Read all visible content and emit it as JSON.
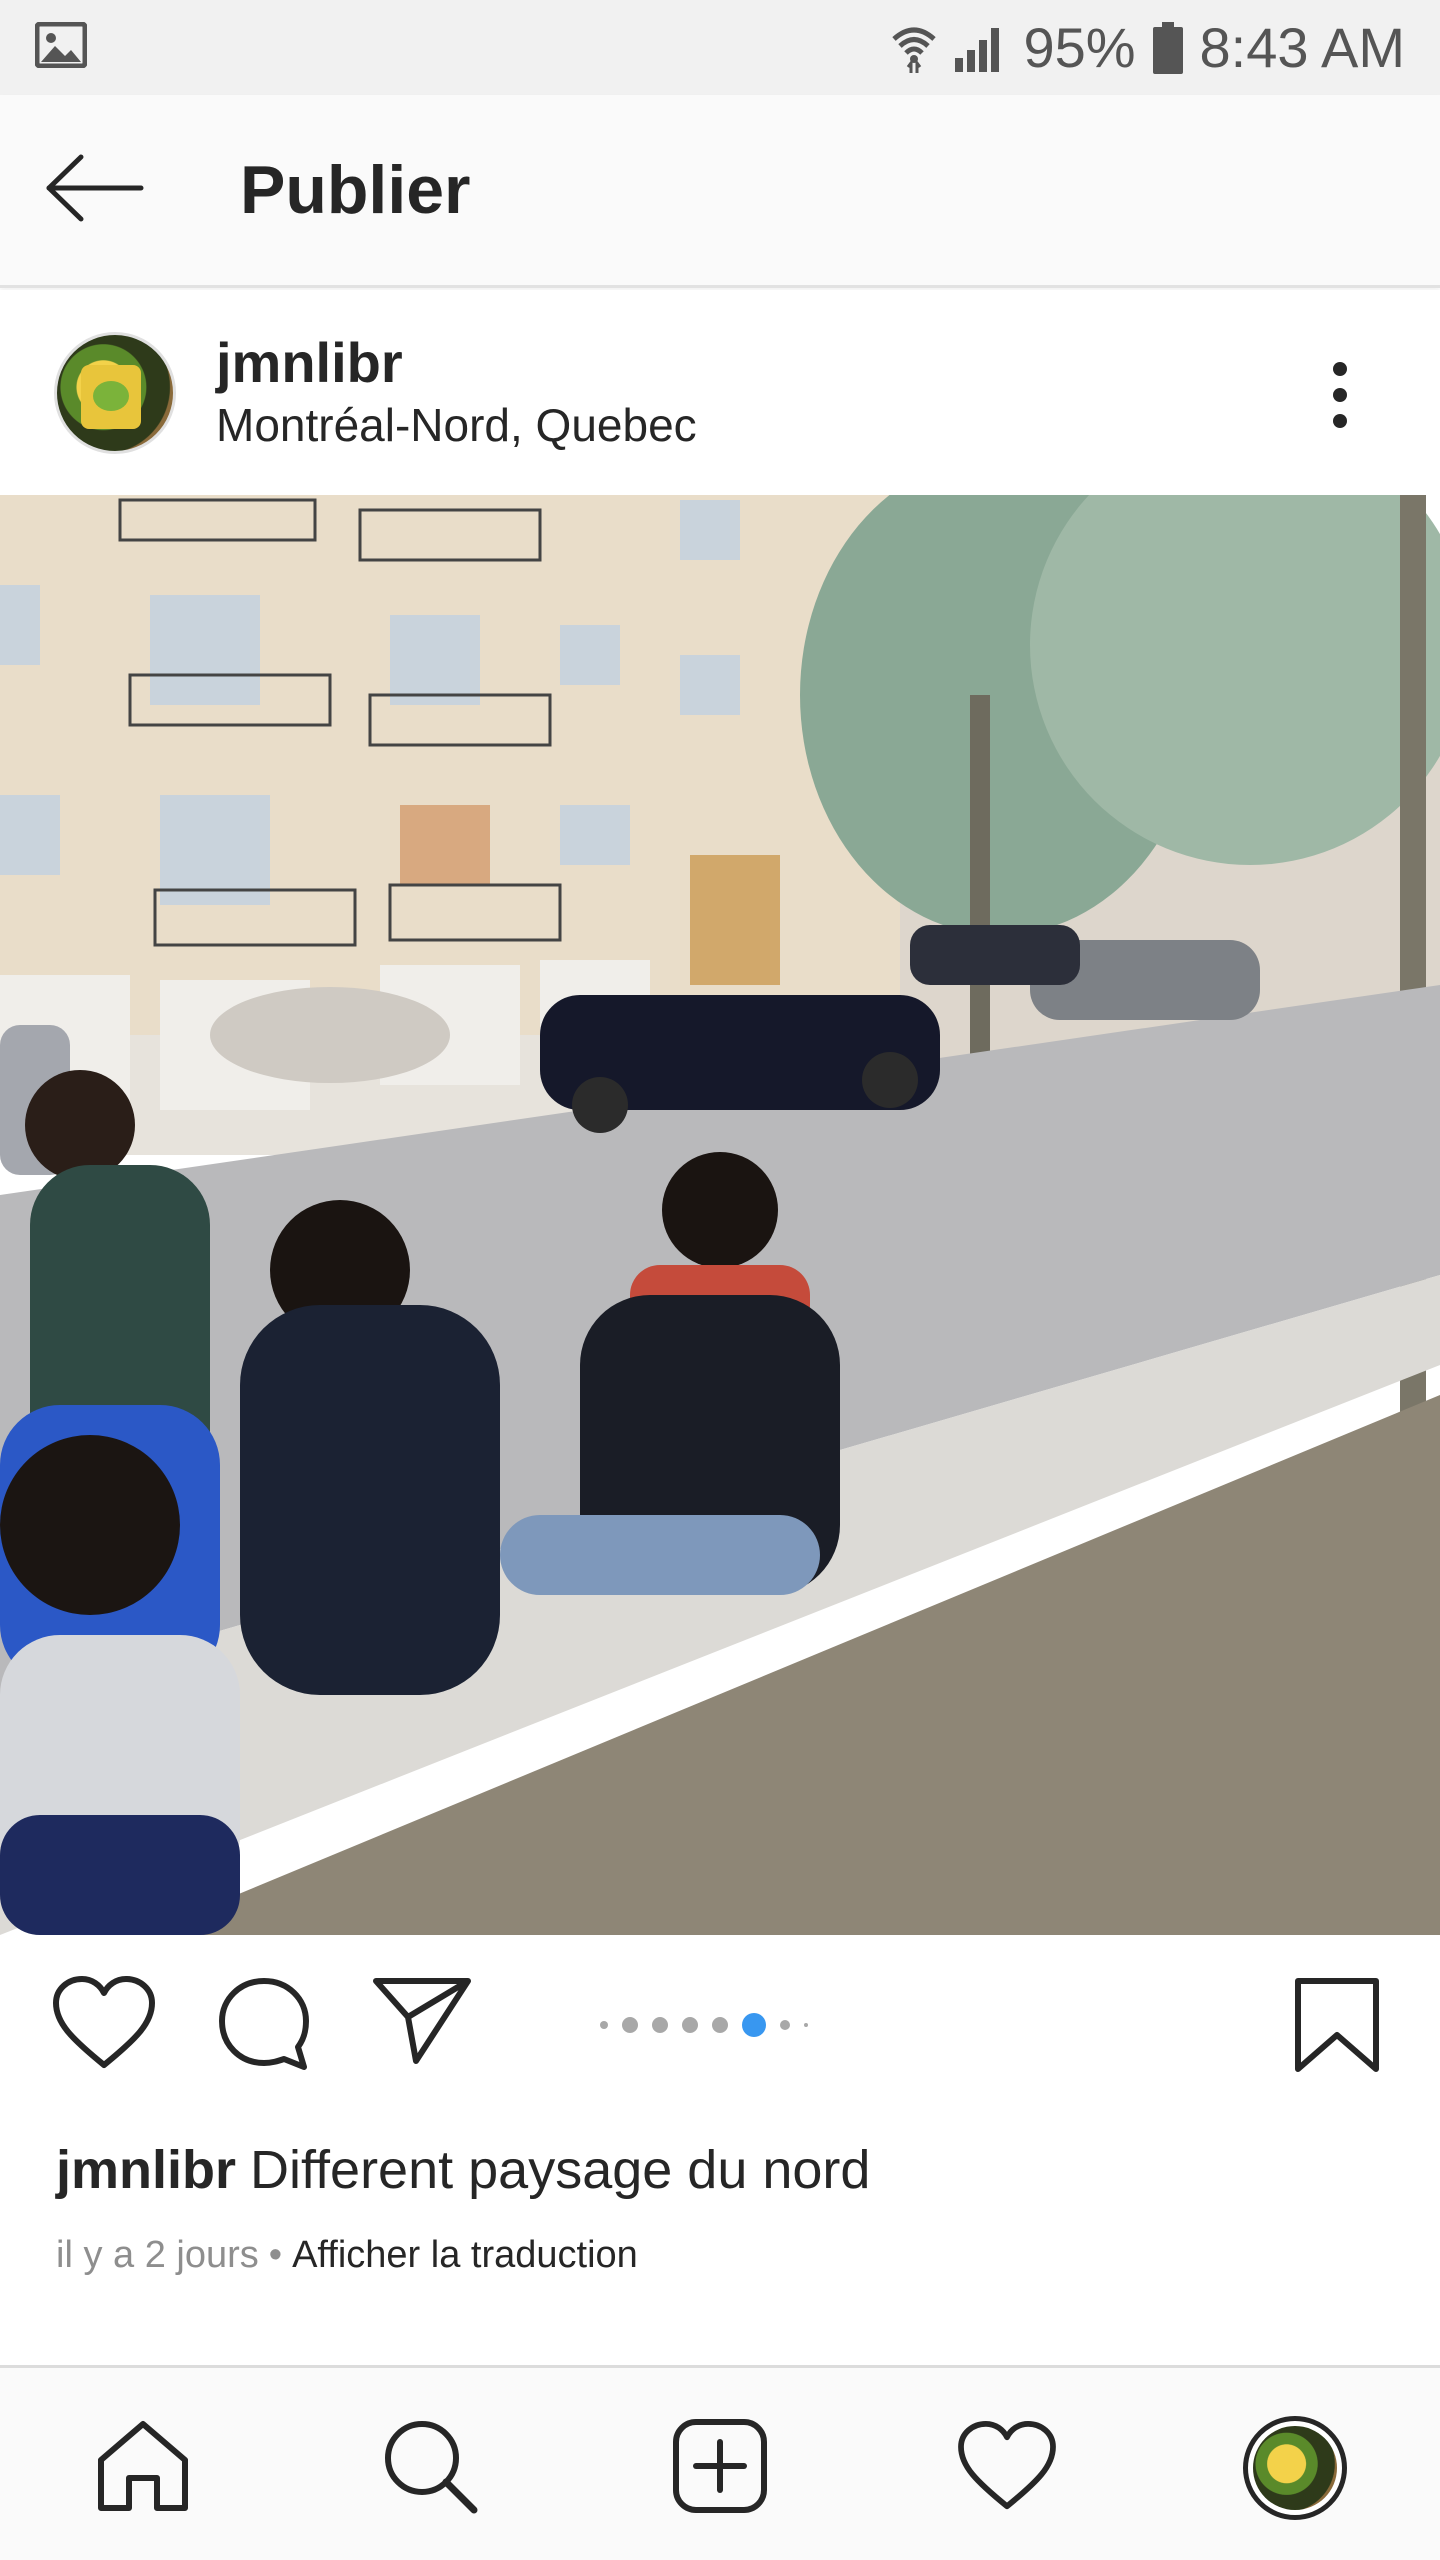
{
  "status_bar": {
    "battery_text": "95%",
    "time": "8:43 AM",
    "icons": [
      "gallery-notification-icon",
      "wifi-icon",
      "signal-icon",
      "battery-icon"
    ]
  },
  "header": {
    "title": "Publier",
    "back_icon": "arrow-left-icon"
  },
  "post": {
    "username": "jmnlibr",
    "location": "Montréal-Nord, Quebec",
    "caption_text": "Different paysage du nord",
    "time_ago": "il y a 2 jours",
    "separator": "•",
    "translate_label": "Afficher la traduction",
    "carousel": {
      "count": 7,
      "active_index": 5
    }
  },
  "actions": [
    "heart-icon",
    "comment-icon",
    "share-icon",
    "bookmark-icon"
  ],
  "bottom_nav": [
    "home-icon",
    "search-icon",
    "add-post-icon",
    "activity-heart-icon",
    "profile-avatar"
  ],
  "colors": {
    "text": "#262626",
    "muted": "#8e8e8e",
    "accent": "#3897f0",
    "status_bar_bg": "#f1f1f1"
  }
}
